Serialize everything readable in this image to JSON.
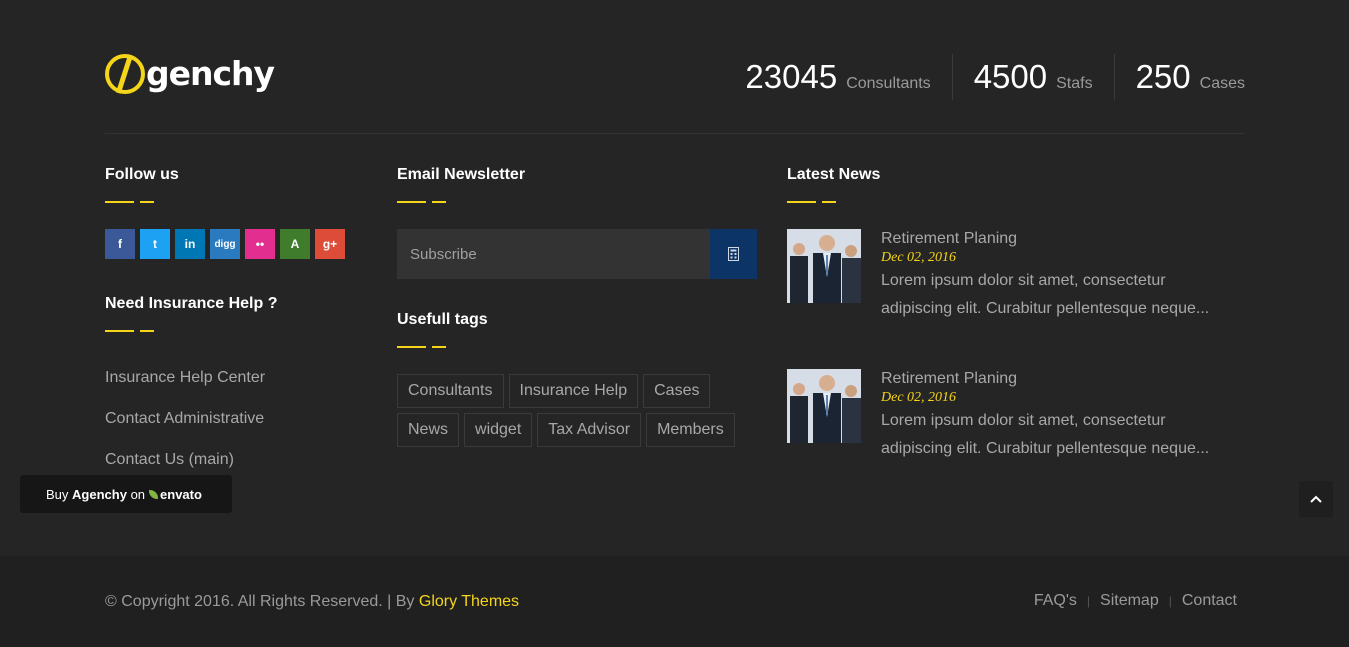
{
  "brand": {
    "name": "genchy",
    "accent": "#f4d51a"
  },
  "stats": [
    {
      "value": "23045",
      "label": "Consultants"
    },
    {
      "value": "4500",
      "label": "Stafs"
    },
    {
      "value": "250",
      "label": "Cases"
    }
  ],
  "follow": {
    "title": "Follow us",
    "networks": [
      {
        "icon": "facebook-icon",
        "glyph": "f",
        "color": "#3b5998"
      },
      {
        "icon": "twitter-icon",
        "glyph": "t",
        "color": "#1da1f2"
      },
      {
        "icon": "linkedin-icon",
        "glyph": "in",
        "color": "#0077b5"
      },
      {
        "icon": "digg-icon",
        "glyph": "digg",
        "color": "#2a7ac0"
      },
      {
        "icon": "flickr-icon",
        "glyph": "••",
        "color": "#e22e8f"
      },
      {
        "icon": "vine-icon",
        "glyph": "A",
        "color": "#3f7d2d"
      },
      {
        "icon": "google-plus-icon",
        "glyph": "g+",
        "color": "#dd4b39"
      }
    ]
  },
  "help": {
    "title": "Need Insurance Help ?",
    "links": [
      "Insurance Help Center",
      "Contact Administrative",
      "Contact Us (main)"
    ]
  },
  "newsletter": {
    "title": "Email Newsletter",
    "placeholder": "Subscribe"
  },
  "tags": {
    "title": "Usefull tags",
    "items": [
      "Consultants",
      "Insurance Help",
      "Cases",
      "News",
      "widget",
      "Tax Advisor",
      "Members"
    ]
  },
  "news": {
    "title": "Latest News",
    "items": [
      {
        "title": "Retirement Planing",
        "date": "Dec 02, 2016",
        "excerpt": "Lorem ipsum dolor sit amet, consectetur adipiscing elit. Curabitur pellentesque neque..."
      },
      {
        "title": "Retirement Planing",
        "date": "Dec 02, 2016",
        "excerpt": "Lorem ipsum dolor sit amet, consectetur adipiscing elit. Curabitur pellentesque neque..."
      }
    ]
  },
  "buy": {
    "prefix": "Buy",
    "product": "Agenchy",
    "on": "on",
    "market": "envato"
  },
  "footer": {
    "copyright": "© Copyright 2016. All Rights Reserved. | By",
    "author": "Glory Themes",
    "links": [
      "FAQ's",
      "Sitemap",
      "Contact"
    ]
  }
}
